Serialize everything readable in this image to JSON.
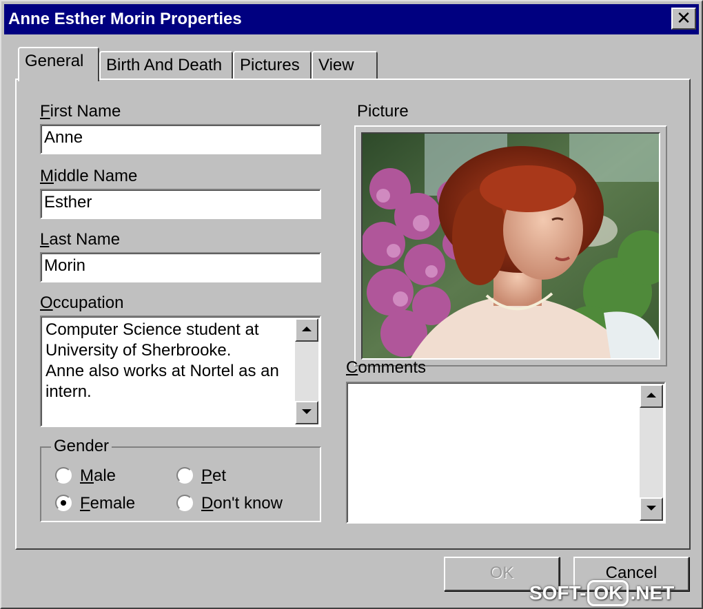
{
  "window": {
    "title": "Anne Esther Morin Properties"
  },
  "tabs": [
    {
      "label": "General",
      "active": true
    },
    {
      "label": "Birth And Death",
      "active": false
    },
    {
      "label": "Pictures",
      "active": false
    },
    {
      "label": "View",
      "active": false
    }
  ],
  "fields": {
    "first_name": {
      "label_ul": "F",
      "label_rest": "irst Name",
      "value": "Anne"
    },
    "middle_name": {
      "label_ul": "M",
      "label_rest": "iddle Name",
      "value": "Esther"
    },
    "last_name": {
      "label_ul": "L",
      "label_rest": "ast Name",
      "value": "Morin"
    },
    "occupation": {
      "label_ul": "O",
      "label_rest": "ccupation",
      "value": "Computer Science student at\nUniversity of Sherbrooke.\nAnne also works at Nortel as an\nintern."
    }
  },
  "gender": {
    "legend": "Gender",
    "options": [
      {
        "ul": "M",
        "rest": "ale",
        "checked": false
      },
      {
        "ul": "P",
        "rest": "et",
        "checked": false
      },
      {
        "ul": "F",
        "rest": "emale",
        "checked": true
      },
      {
        "ul": "D",
        "rest": "on't know",
        "checked": false
      }
    ]
  },
  "picture": {
    "label": "Picture"
  },
  "comments": {
    "label_ul": "C",
    "label_rest": "omments",
    "value": ""
  },
  "buttons": {
    "ok": "OK",
    "cancel": "Cancel"
  },
  "watermark": {
    "left": "SOFT-",
    "box": "OK",
    "right": ".NET"
  }
}
